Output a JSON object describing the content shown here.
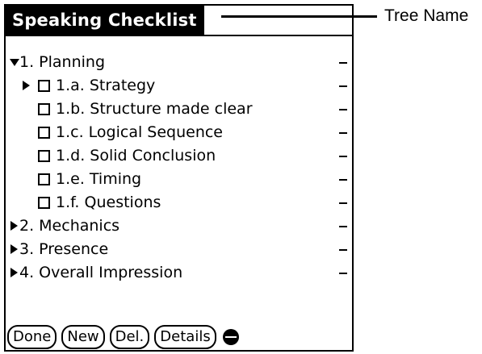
{
  "title": "Speaking Checklist",
  "callout_label": "Tree Name",
  "tree": [
    {
      "label": "1. Planning",
      "indent": 0,
      "toggle": "expanded",
      "checkbox": false
    },
    {
      "label": "1.a. Strategy",
      "indent": 1,
      "toggle": "collapsed",
      "checkbox": true
    },
    {
      "label": "1.b. Structure made clear",
      "indent": 1,
      "toggle": "none",
      "checkbox": true
    },
    {
      "label": "1.c. Logical Sequence",
      "indent": 1,
      "toggle": "none",
      "checkbox": true
    },
    {
      "label": "1.d. Solid Conclusion",
      "indent": 1,
      "toggle": "none",
      "checkbox": true
    },
    {
      "label": "1.e. Timing",
      "indent": 1,
      "toggle": "none",
      "checkbox": true
    },
    {
      "label": "1.f. Questions",
      "indent": 1,
      "toggle": "none",
      "checkbox": true
    },
    {
      "label": "2. Mechanics",
      "indent": 0,
      "toggle": "collapsed",
      "checkbox": false
    },
    {
      "label": "3. Presence",
      "indent": 0,
      "toggle": "collapsed",
      "checkbox": false
    },
    {
      "label": "4. Overall Impression",
      "indent": 0,
      "toggle": "collapsed",
      "checkbox": false
    }
  ],
  "buttons": {
    "done": "Done",
    "new": "New",
    "del": "Del.",
    "details": "Details"
  }
}
